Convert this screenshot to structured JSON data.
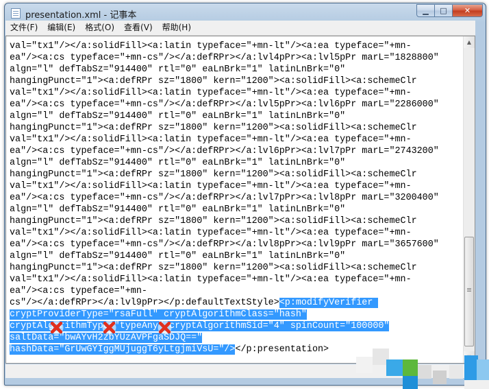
{
  "window": {
    "title": "presentation.xml - 记事本",
    "caption": {
      "minimize": "▁",
      "maximize": "□",
      "close": "✕"
    }
  },
  "menu": [
    {
      "label": "文件(F)"
    },
    {
      "label": "编辑(E)"
    },
    {
      "label": "格式(O)"
    },
    {
      "label": "查看(V)"
    },
    {
      "label": "帮助(H)"
    }
  ],
  "editor": {
    "lines": [
      {
        "pre": "val=\"tx1\"/></a:solidFill><a:latin typeface=\"+mn-lt\"/><a:ea typeface=\"+mn-",
        "sel": "",
        "post": ""
      },
      {
        "pre": "ea\"/><a:cs typeface=\"+mn-cs\"/></a:defRPr></a:lvl4pPr><a:lvl5pPr marL=\"1828800\"",
        "sel": "",
        "post": ""
      },
      {
        "pre": "algn=\"l\" defTabSz=\"914400\" rtl=\"0\" eaLnBrk=\"1\" latinLnBrk=\"0\"",
        "sel": "",
        "post": ""
      },
      {
        "pre": "hangingPunct=\"1\"><a:defRPr sz=\"1800\" kern=\"1200\"><a:solidFill><a:schemeClr",
        "sel": "",
        "post": ""
      },
      {
        "pre": "val=\"tx1\"/></a:solidFill><a:latin typeface=\"+mn-lt\"/><a:ea typeface=\"+mn-",
        "sel": "",
        "post": ""
      },
      {
        "pre": "ea\"/><a:cs typeface=\"+mn-cs\"/></a:defRPr></a:lvl5pPr><a:lvl6pPr marL=\"2286000\"",
        "sel": "",
        "post": ""
      },
      {
        "pre": "algn=\"l\" defTabSz=\"914400\" rtl=\"0\" eaLnBrk=\"1\" latinLnBrk=\"0\"",
        "sel": "",
        "post": ""
      },
      {
        "pre": "hangingPunct=\"1\"><a:defRPr sz=\"1800\" kern=\"1200\"><a:solidFill><a:schemeClr",
        "sel": "",
        "post": ""
      },
      {
        "pre": "val=\"tx1\"/></a:solidFill><a:latin typeface=\"+mn-lt\"/><a:ea typeface=\"+mn-",
        "sel": "",
        "post": ""
      },
      {
        "pre": "ea\"/><a:cs typeface=\"+mn-cs\"/></a:defRPr></a:lvl6pPr><a:lvl7pPr marL=\"2743200\"",
        "sel": "",
        "post": ""
      },
      {
        "pre": "algn=\"l\" defTabSz=\"914400\" rtl=\"0\" eaLnBrk=\"1\" latinLnBrk=\"0\"",
        "sel": "",
        "post": ""
      },
      {
        "pre": "hangingPunct=\"1\"><a:defRPr sz=\"1800\" kern=\"1200\"><a:solidFill><a:schemeClr",
        "sel": "",
        "post": ""
      },
      {
        "pre": "val=\"tx1\"/></a:solidFill><a:latin typeface=\"+mn-lt\"/><a:ea typeface=\"+mn-",
        "sel": "",
        "post": ""
      },
      {
        "pre": "ea\"/><a:cs typeface=\"+mn-cs\"/></a:defRPr></a:lvl7pPr><a:lvl8pPr marL=\"3200400\"",
        "sel": "",
        "post": ""
      },
      {
        "pre": "algn=\"l\" defTabSz=\"914400\" rtl=\"0\" eaLnBrk=\"1\" latinLnBrk=\"0\"",
        "sel": "",
        "post": ""
      },
      {
        "pre": "hangingPunct=\"1\"><a:defRPr sz=\"1800\" kern=\"1200\"><a:solidFill><a:schemeClr",
        "sel": "",
        "post": ""
      },
      {
        "pre": "val=\"tx1\"/></a:solidFill><a:latin typeface=\"+mn-lt\"/><a:ea typeface=\"+mn-",
        "sel": "",
        "post": ""
      },
      {
        "pre": "ea\"/><a:cs typeface=\"+mn-cs\"/></a:defRPr></a:lvl8pPr><a:lvl9pPr marL=\"3657600\"",
        "sel": "",
        "post": ""
      },
      {
        "pre": "algn=\"l\" defTabSz=\"914400\" rtl=\"0\" eaLnBrk=\"1\" latinLnBrk=\"0\"",
        "sel": "",
        "post": ""
      },
      {
        "pre": "hangingPunct=\"1\"><a:defRPr sz=\"1800\" kern=\"1200\"><a:solidFill><a:schemeClr",
        "sel": "",
        "post": ""
      },
      {
        "pre": "val=\"tx1\"/></a:solidFill><a:latin typeface=\"+mn-lt\"/><a:ea typeface=\"+mn-",
        "sel": "",
        "post": ""
      },
      {
        "pre": "ea\"/><a:cs typeface=\"+mn-",
        "sel": "",
        "post": ""
      },
      {
        "pre": "cs\"/></a:defRPr></a:lvl9pPr></p:defaultTextStyle>",
        "sel": "<p:modifyVerifier ",
        "post": ""
      },
      {
        "pre": "",
        "sel": "cryptProviderType=\"rsaFull\" cryptAlgorithmClass=\"hash\"",
        "post": ""
      },
      {
        "pre": "",
        "sel": "cryptAlgorithmType=\"typeAny\" cryptAlgorithmSid=\"4\" spinCount=\"100000\"",
        "post": ""
      },
      {
        "pre": "",
        "sel": "saltData=\"bwAYvH2zbYUzAVPFgaSDJQ==\"",
        "post": ""
      },
      {
        "pre": "",
        "sel": "hashData=\"GrUwGYIggMUjuggT6yLtgjmiVsU=\"/>",
        "post": "</p:presentation>"
      }
    ]
  },
  "colors": {
    "selection": "#3399ff",
    "mark": "#e0301e"
  }
}
